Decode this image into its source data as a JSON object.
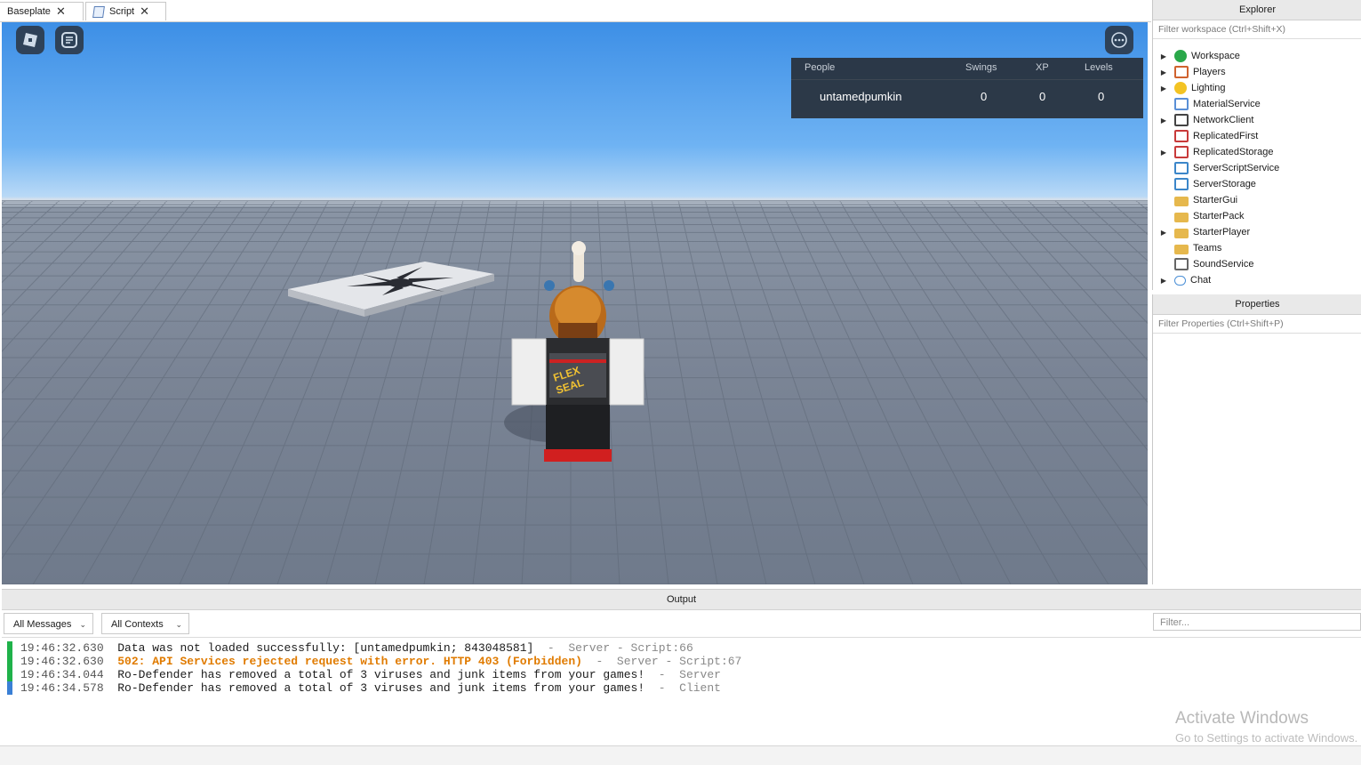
{
  "tabs": [
    {
      "label": "Baseplate"
    },
    {
      "label": "Script"
    }
  ],
  "viewport": {
    "roblox_button": "roblox-menu",
    "chat_button": "chat",
    "more_button": "more-options"
  },
  "leaderboard": {
    "headers": [
      "People",
      "Swings",
      "XP",
      "Levels"
    ],
    "row": {
      "name": "untamedpumkin",
      "swings": "0",
      "xp": "0",
      "levels": "0"
    }
  },
  "explorer": {
    "title": "Explorer",
    "filter_placeholder": "Filter workspace (Ctrl+Shift+X)",
    "items": [
      {
        "label": "Workspace",
        "expandable": true,
        "icon": "globe-icon"
      },
      {
        "label": "Players",
        "expandable": true,
        "icon": "players-icon"
      },
      {
        "label": "Lighting",
        "expandable": true,
        "icon": "lightbulb-icon"
      },
      {
        "label": "MaterialService",
        "expandable": false,
        "icon": "material-icon"
      },
      {
        "label": "NetworkClient",
        "expandable": true,
        "icon": "network-icon"
      },
      {
        "label": "ReplicatedFirst",
        "expandable": false,
        "icon": "replicated-icon"
      },
      {
        "label": "ReplicatedStorage",
        "expandable": true,
        "icon": "replicated-storage-icon"
      },
      {
        "label": "ServerScriptService",
        "expandable": false,
        "icon": "server-script-icon"
      },
      {
        "label": "ServerStorage",
        "expandable": false,
        "icon": "server-storage-icon"
      },
      {
        "label": "StarterGui",
        "expandable": false,
        "icon": "folder-icon"
      },
      {
        "label": "StarterPack",
        "expandable": false,
        "icon": "folder-icon"
      },
      {
        "label": "StarterPlayer",
        "expandable": true,
        "icon": "folder-icon"
      },
      {
        "label": "Teams",
        "expandable": false,
        "icon": "folder-icon"
      },
      {
        "label": "SoundService",
        "expandable": false,
        "icon": "speaker-icon"
      },
      {
        "label": "Chat",
        "expandable": true,
        "icon": "chat-icon"
      }
    ]
  },
  "properties": {
    "title": "Properties",
    "filter_placeholder": "Filter Properties (Ctrl+Shift+P)"
  },
  "output": {
    "title": "Output",
    "message_filter": "All Messages",
    "context_filter": "All Contexts",
    "search_placeholder": "Filter...",
    "lines": [
      {
        "time": "19:46:32.630",
        "text": "Data was not loaded successfully: [untamedpumkin; 843048581]",
        "source": "  -  Server - Script:66",
        "level": "info",
        "bar": "#1fb24a"
      },
      {
        "time": "19:46:32.630",
        "text": "502: API Services rejected request with error. HTTP 403 (Forbidden)",
        "source": "  -  Server - Script:67",
        "level": "warning",
        "bar": "#1fb24a"
      },
      {
        "time": "19:46:34.044",
        "text": "Ro-Defender has removed a total of 3 viruses and junk items from your games!",
        "source": "  -  Server",
        "level": "info",
        "bar": "#1fb24a"
      },
      {
        "time": "19:46:34.578",
        "text": "Ro-Defender has removed a total of 3 viruses and junk items from your games!",
        "source": "  -  Client",
        "level": "info",
        "bar": "#3a7fd5"
      }
    ]
  },
  "watermark": {
    "line1": "Activate Windows",
    "line2": "Go to Settings to activate Windows."
  },
  "colors": {
    "warning": "#e07b00",
    "server_bar": "#1fb24a",
    "client_bar": "#3a7fd5"
  }
}
